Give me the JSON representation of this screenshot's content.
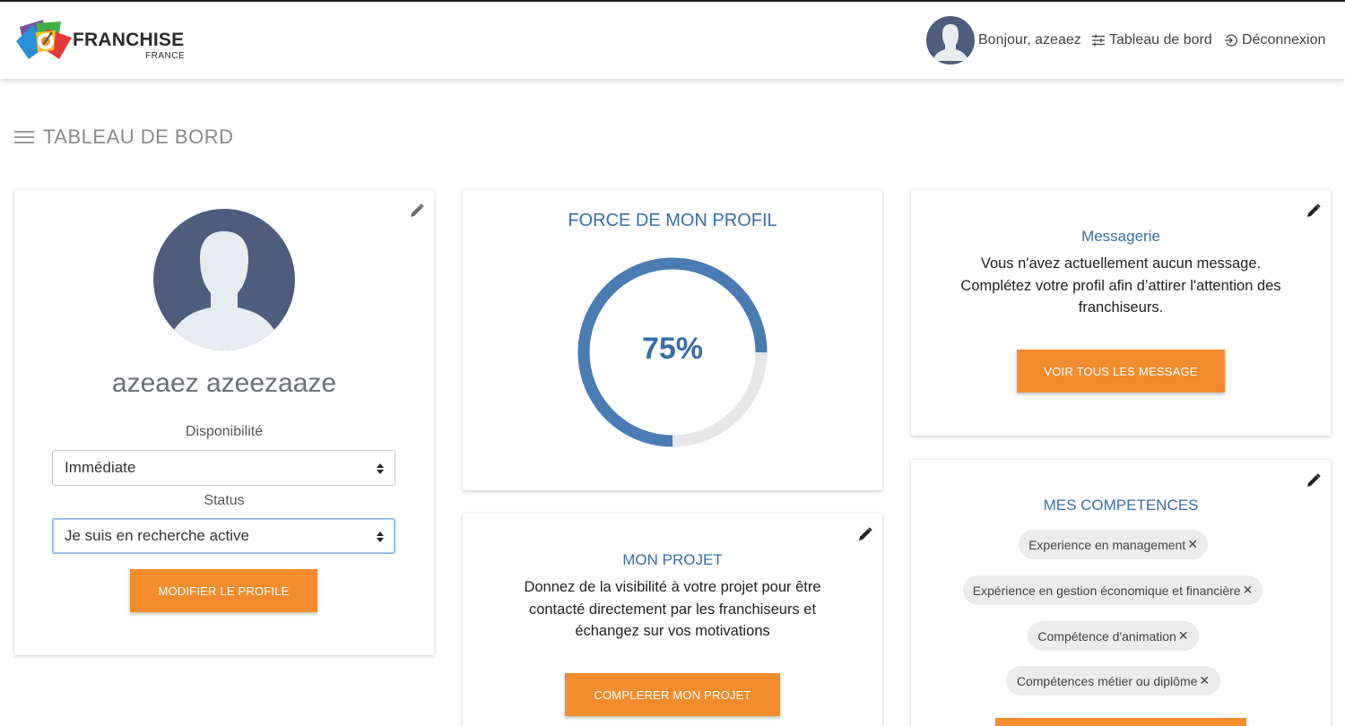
{
  "header": {
    "logo_title": "FRANCHISE",
    "logo_subtitle": "FRANCE",
    "greeting": "Bonjour, azeaez",
    "dashboard_link": "Tableau de bord",
    "logout_link": "Déconnexion"
  },
  "page": {
    "title": "TABLEAU DE BORD"
  },
  "profile_card": {
    "name": "azeaez azeezaaze",
    "availability_label": "Disponibilité",
    "availability_value": "Immédiate",
    "status_label": "Status",
    "status_value": "Je suis en recherche active",
    "button": "MODIFIER LE PROFILE"
  },
  "strength_card": {
    "title": "FORCE DE MON PROFIL",
    "percent_label": "75%",
    "percent": 75,
    "color_fill": "#4a7bb2",
    "color_track": "#e6e6e6"
  },
  "project_card": {
    "title": "MON PROJET",
    "text": "Donnez de la visibilité à votre projet pour être contacté directement par les franchiseurs et échangez sur vos motivations",
    "button": "COMPLERER MON PROJET"
  },
  "messages_card": {
    "title": "Messagerie",
    "text": "Vous n'avez actuellement aucun message. Complétez votre profil afin d’attirer l'attention des franchiseurs.",
    "button": "VOIR TOUS LES MESSAGE"
  },
  "skills_card": {
    "title": "MES COMPETENCES",
    "chips": [
      "Experience en management",
      "Expérience en gestion économique et financière",
      "Compétence d'animation",
      "Compétences métier ou diplôme"
    ],
    "remove_symbol": "✕"
  },
  "colors": {
    "accent": "#f28c2e",
    "title_blue": "#3a6da8",
    "avatar": "#4e5d7e"
  },
  "icons": [
    "user-avatar-icon",
    "sliders-icon",
    "logout-icon",
    "menu-icon",
    "pencil-icon",
    "select-arrows-icon",
    "remove-icon"
  ]
}
